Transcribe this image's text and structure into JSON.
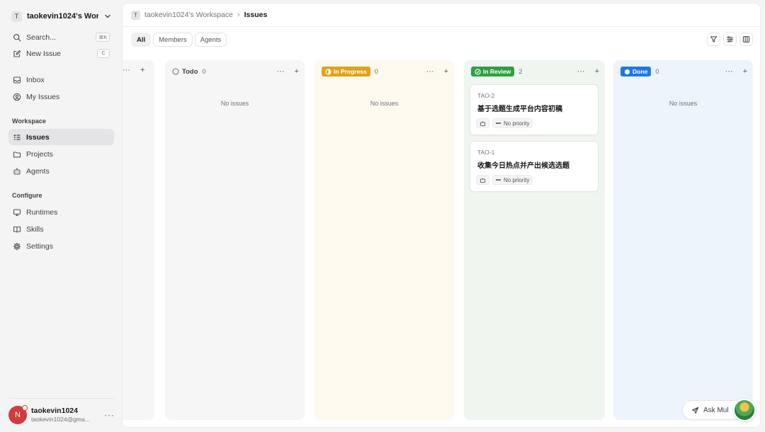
{
  "workspace": {
    "initial": "T",
    "name": "taokevin1024's Wor..."
  },
  "sidebar": {
    "search": {
      "label": "Search...",
      "shortcut": "⌘K"
    },
    "new_issue": {
      "label": "New Issue",
      "shortcut": "C"
    },
    "inbox": "Inbox",
    "my_issues": "My Issues",
    "workspace_section": "Workspace",
    "issues": "Issues",
    "projects": "Projects",
    "agents": "Agents",
    "configure_section": "Configure",
    "runtimes": "Runtimes",
    "skills": "Skills",
    "settings": "Settings"
  },
  "user": {
    "initial": "N",
    "name": "taokevin1024",
    "email": "taokevin1024@gma...",
    "more": "···"
  },
  "breadcrumb": {
    "initial": "T",
    "workspace": "taokevin1024's Workspace",
    "separator": "›",
    "current": "Issues"
  },
  "filters": {
    "all": "All",
    "members": "Members",
    "agents": "Agents"
  },
  "board": {
    "columns": [
      {
        "title": "Todo",
        "count": "0",
        "empty": "No issues"
      },
      {
        "title": "In Progress",
        "count": "0",
        "empty": "No issues",
        "color": "#e0a21a"
      },
      {
        "title": "In Review",
        "count": "2",
        "color": "#2f9e44"
      },
      {
        "title": "Done",
        "count": "0",
        "empty": "No issues",
        "color": "#1f7ae0"
      }
    ],
    "cards": [
      {
        "id": "TAO-2",
        "title": "基于选题生成平台内容初稿",
        "priority": "No priority"
      },
      {
        "id": "TAO-1",
        "title": "收集今日热点并产出候选选题",
        "priority": "No priority"
      }
    ],
    "col_more": "···",
    "col_add": "+"
  },
  "ask": {
    "label": "Ask Mul"
  },
  "colors": {
    "todo_bg": "#f6f6f7",
    "progress_bg": "#fdf9ef",
    "review_bg": "#eff5ef",
    "done_bg": "#eef4fc"
  }
}
